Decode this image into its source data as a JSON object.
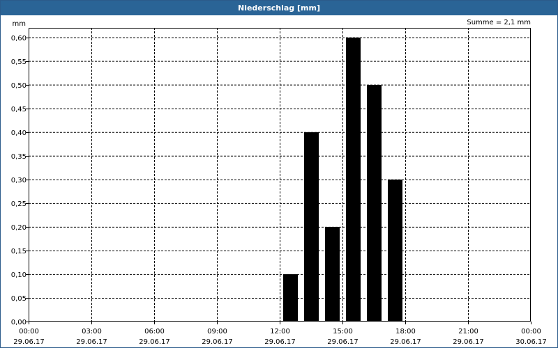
{
  "window": {
    "title": "Niederschlag [mm]"
  },
  "chart_data": {
    "type": "bar",
    "title": "Niederschlag [mm]",
    "ylabel": "mm",
    "annotation": "Summe = 2,1 mm",
    "ylim": [
      0,
      0.62
    ],
    "yticks": [
      0,
      0.05,
      0.1,
      0.15,
      0.2,
      0.25,
      0.3,
      0.35,
      0.4,
      0.45,
      0.5,
      0.55,
      0.6
    ],
    "ytick_labels": [
      "0,00",
      "0,05",
      "0,10",
      "0,15",
      "0,20",
      "0,25",
      "0,30",
      "0,35",
      "0,40",
      "0,45",
      "0,50",
      "0,55",
      "0,60"
    ],
    "xlim": [
      "29.06.17 00:00",
      "30.06.17 00:00"
    ],
    "xticks": [
      {
        "time": "00:00",
        "date": "29.06.17"
      },
      {
        "time": "03:00",
        "date": "29.06.17"
      },
      {
        "time": "06:00",
        "date": "29.06.17"
      },
      {
        "time": "09:00",
        "date": "29.06.17"
      },
      {
        "time": "12:00",
        "date": "29.06.17"
      },
      {
        "time": "15:00",
        "date": "29.06.17"
      },
      {
        "time": "18:00",
        "date": "29.06.17"
      },
      {
        "time": "21:00",
        "date": "29.06.17"
      },
      {
        "time": "00:00",
        "date": "30.06.17"
      }
    ],
    "grid": true,
    "bar_color": "#000000",
    "bars": [
      {
        "x": "29.06.17 12:00",
        "value": 0.1
      },
      {
        "x": "29.06.17 13:00",
        "value": 0.4
      },
      {
        "x": "29.06.17 14:00",
        "value": 0.2
      },
      {
        "x": "29.06.17 15:00",
        "value": 0.6
      },
      {
        "x": "29.06.17 16:00",
        "value": 0.5
      },
      {
        "x": "29.06.17 17:00",
        "value": 0.3
      }
    ]
  }
}
